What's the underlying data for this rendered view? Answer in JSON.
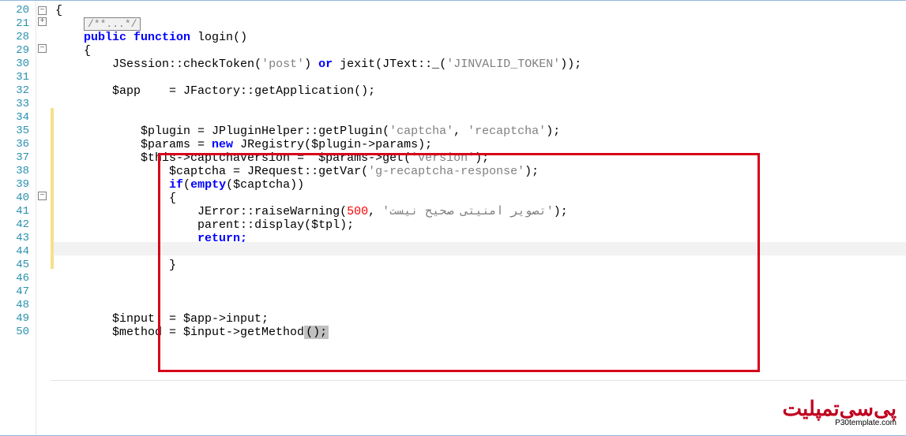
{
  "gutter": {
    "start": 20,
    "end": 50
  },
  "fold": {
    "row20": "−",
    "row21": "+",
    "row29": "−",
    "row40": "−"
  },
  "code": {
    "l20": "{",
    "l21_fold": "/**...*/",
    "l28": {
      "a": "public function ",
      "b": "login",
      "c": "()"
    },
    "l29": "{",
    "l30": {
      "a": "JSession",
      "b": "::",
      "c": "checkToken",
      "d": "(",
      "e": "'post'",
      "f": ") ",
      "g": "or ",
      "h": "jexit",
      "i": "(JText",
      "j": "::",
      "k": "_",
      "l": "(",
      "m": "'JINVALID_TOKEN'",
      "n": "));"
    },
    "l31": "",
    "l32": {
      "a": "$app    = JFactory",
      "b": "::",
      "c": "getApplication",
      "d": "();"
    },
    "l33": "",
    "l34": "",
    "l35": {
      "a": "$plugin = JPluginHelper",
      "b": "::",
      "c": "getPlugin",
      "d": "(",
      "e": "'captcha'",
      "f": ", ",
      "g": "'recaptcha'",
      "h": ");"
    },
    "l36": {
      "a": "$params = ",
      "b": "new ",
      "c": "JRegistry",
      "d": "($plugin->params);"
    },
    "l37": {
      "a": "$this->captchaVersion =  $params->get(",
      "b": "'version'",
      "c": ");"
    },
    "l38": {
      "a": "$captcha = JRequest",
      "b": "::",
      "c": "getVar",
      "d": "(",
      "e": "'g-recaptcha-response'",
      "f": ");"
    },
    "l39": {
      "a": "if",
      "b": "(",
      "c": "empty",
      "d": "($captcha))"
    },
    "l40": "{",
    "l41": {
      "a": "JError",
      "b": "::",
      "c": "raiseWarning",
      "d": "(",
      "e": "500",
      "f": ", ",
      "g": "'تصویر امنیتی صحیح نیست'",
      "h": ");"
    },
    "l42": {
      "a": "parent",
      "b": "::",
      "c": "display",
      "d": "($tpl);"
    },
    "l43": "return;",
    "l44": "",
    "l45": "}",
    "l46": "",
    "l47": "",
    "l48": "",
    "l49": "$input  = $app->input;",
    "l50": {
      "a": "$method = $input->getMethod",
      "b": "();"
    }
  },
  "watermark": {
    "logo": "پی‌سی‌تمپلیت",
    "url": "P30template.com"
  }
}
